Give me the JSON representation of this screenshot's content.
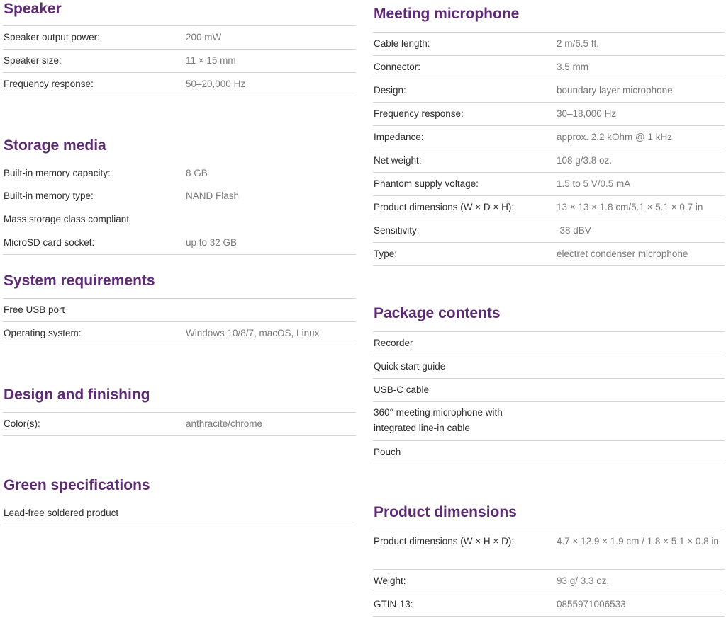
{
  "speaker": {
    "title": "Speaker",
    "rows": [
      {
        "label": "Speaker output power:",
        "value": "200 mW"
      },
      {
        "label": "Speaker size:",
        "value": "11 × 15 mm"
      },
      {
        "label": "Frequency response:",
        "value": "50–20,000 Hz"
      }
    ]
  },
  "storage": {
    "title": "Storage media",
    "rows": [
      {
        "label": "Built-in memory capacity:",
        "value": "8 GB"
      },
      {
        "label": "Built-in memory type:",
        "value": "NAND Flash"
      },
      {
        "label": "Mass storage class compliant"
      },
      {
        "label": "MicroSD card socket:",
        "value": "up to 32 GB"
      }
    ]
  },
  "system": {
    "title": "System requirements",
    "rows": [
      {
        "label": "Free USB port"
      },
      {
        "label": "Operating system:",
        "value": "Windows 10/8/7, macOS, Linux"
      }
    ]
  },
  "design": {
    "title": "Design and finishing",
    "rows": [
      {
        "label": "Color(s):",
        "value": "anthracite/chrome"
      }
    ]
  },
  "green": {
    "title": "Green specifications",
    "rows": [
      {
        "label": "Lead-free soldered product"
      }
    ]
  },
  "mic": {
    "title": "Meeting microphone",
    "rows": [
      {
        "label": "Cable length:",
        "value": "2 m/6.5 ft."
      },
      {
        "label": "Connector:",
        "value": "3.5 mm"
      },
      {
        "label": "Design:",
        "value": "boundary layer microphone"
      },
      {
        "label": "Frequency response:",
        "value": "30–18,000 Hz"
      },
      {
        "label": "Impedance:",
        "value": "approx. 2.2 kOhm @ 1 kHz"
      },
      {
        "label": "Net weight:",
        "value": "108 g/3.8 oz."
      },
      {
        "label": "Phantom supply voltage:",
        "value": "1.5 to 5 V/0.5 mA"
      },
      {
        "label": "Product dimensions (W × D × H):",
        "value": "13 × 13 × 1.8 cm/5.1 × 5.1 × 0.7 in"
      },
      {
        "label": "Sensitivity:",
        "value": "-38 dBV"
      },
      {
        "label": "Type:",
        "value": "electret condenser microphone"
      }
    ]
  },
  "package": {
    "title": "Package contents",
    "rows": [
      {
        "label": "Recorder"
      },
      {
        "label": "Quick start guide"
      },
      {
        "label": "USB-C cable"
      },
      {
        "label": "360° meeting microphone with integrated line-in cable"
      },
      {
        "label": "Pouch"
      }
    ]
  },
  "dimensions": {
    "title": "Product dimensions",
    "rows": [
      {
        "label": "Product dimensions (W × H × D):",
        "value": "4.7 × 12.9 × 1.9 cm / 1.8 × 5.1 × 0.8 in"
      },
      {
        "label": "Weight:",
        "value": "93 g/ 3.3 oz."
      },
      {
        "label": "GTIN-13:",
        "value": "0855971006533"
      }
    ]
  }
}
